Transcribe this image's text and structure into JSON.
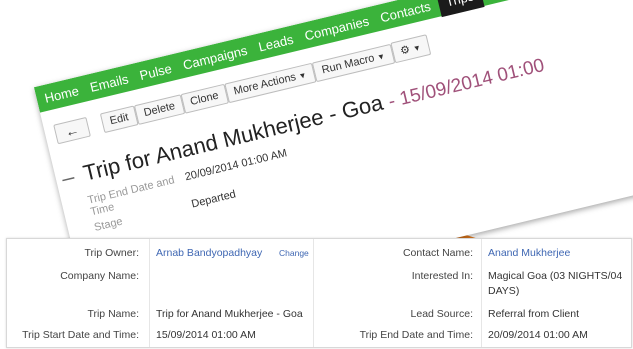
{
  "nav": {
    "items": [
      "Home",
      "Emails",
      "Pulse",
      "Campaigns",
      "Leads",
      "Companies",
      "Contacts",
      "Trips"
    ]
  },
  "toolbar": {
    "back_icon": "arrow-left-icon",
    "edit_label": "Edit",
    "delete_label": "Delete",
    "clone_label": "Clone",
    "more_actions_label": "More Actions",
    "run_macro_label": "Run Macro",
    "settings_icon": "gear-icon"
  },
  "record": {
    "title": "Trip for Anand Mukherjee - Goa",
    "title_date": "- 15/09/2014 01:00",
    "end_label": "Trip End Date and Time",
    "end_value": "20/09/2014 01:00 AM",
    "stage_label": "Stage",
    "stage_value": "Departed"
  },
  "details": {
    "trip_owner_label": "Trip Owner:",
    "trip_owner_value": "Arnab Bandyopadhyay",
    "change_label": "Change",
    "company_name_label": "Company Name:",
    "company_name_value": "",
    "trip_name_label": "Trip Name:",
    "trip_name_value": "Trip for Anand Mukherjee - Goa",
    "trip_start_label": "Trip Start Date and Time:",
    "trip_start_value": "15/09/2014 01:00 AM",
    "contact_name_label": "Contact Name:",
    "contact_name_value": "Anand Mukherjee",
    "interested_in_label": "Interested In:",
    "interested_in_line1": "Magical Goa (03 NIGHTS/04",
    "interested_in_line2": "DAYS)",
    "lead_source_label": "Lead Source:",
    "lead_source_value": "Referral from Client",
    "trip_end_label": "Trip End Date and Time:",
    "trip_end_value": "20/09/2014 01:00 AM"
  },
  "colors": {
    "nav_green": "#3bb33b",
    "accent_orange": "#e87d1e",
    "link_blue": "#3f67b3",
    "date_pink": "#a0517a"
  }
}
